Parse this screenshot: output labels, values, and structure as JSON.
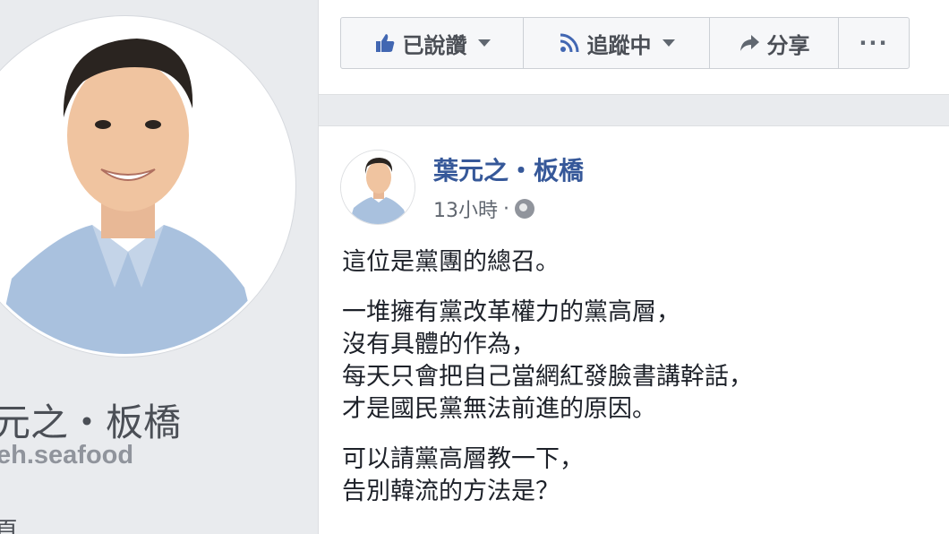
{
  "profile": {
    "name": "元之・板橋",
    "handle": "eh.seafood",
    "more_text": "頁"
  },
  "action_bar": {
    "like_label": "已說讚",
    "follow_label": "追蹤中",
    "share_label": "分享",
    "more_label": "···"
  },
  "post": {
    "author": "葉元之・板橋",
    "time": "13小時",
    "separator": "·",
    "paragraphs": [
      [
        "這位是黨團的總召。"
      ],
      [
        "一堆擁有黨改革權力的黨高層，",
        "沒有具體的作為，",
        "每天只會把自己當網紅發臉書講幹話，",
        "才是國民黨無法前進的原因。"
      ],
      [
        "可以請黨高層教一下，",
        "告別韓流的方法是？"
      ]
    ]
  },
  "colors": {
    "background": "#e9ebee",
    "link_blue": "#365899",
    "shirt_blue": "#a9c1de"
  }
}
